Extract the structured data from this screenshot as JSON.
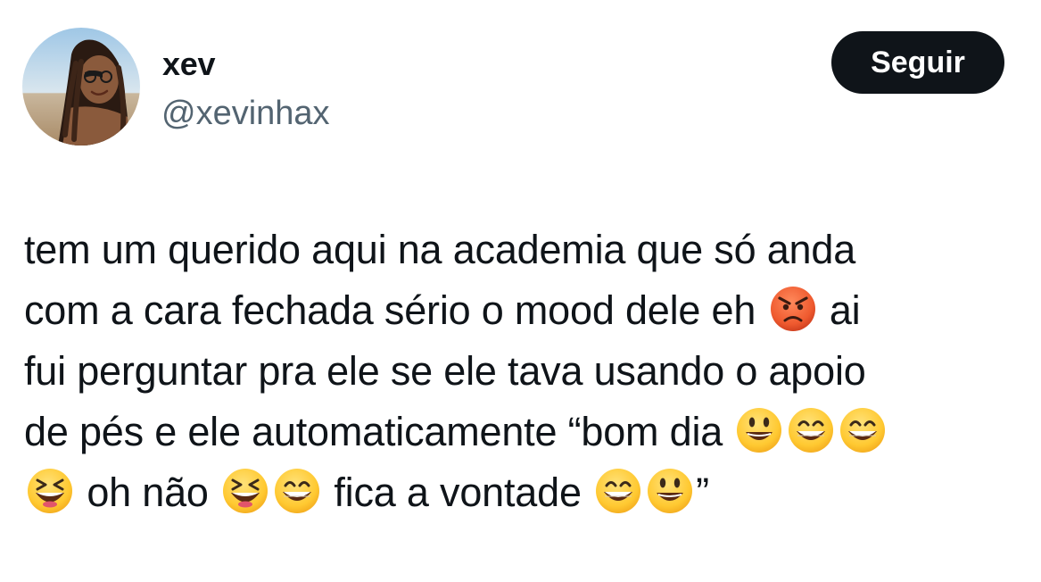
{
  "user": {
    "display_name": "xev",
    "handle": "@xevinhax",
    "avatar_icon": "profile-photo"
  },
  "actions": {
    "follow_label": "Seguir"
  },
  "tweet": {
    "line1": "tem um querido aqui na academia que só anda",
    "line2_a": "com a cara fechada sério o mood dele eh",
    "line2_b": "ai",
    "line3": "fui perguntar pra ele se ele tava usando o apoio",
    "line4_a": "de pés e ele automaticamente “bom dia",
    "line5_a": "oh não",
    "line5_b": "fica a vontade",
    "line5_c": "”"
  },
  "emojis": {
    "angry": "angry-face",
    "smiley": "grinning-face-big-eyes",
    "grin": "beaming-face-smiling-eyes",
    "laugh": "grinning-squinting-face"
  },
  "colors": {
    "text": "#0f1419",
    "secondary": "#536471",
    "button_bg": "#0f1419",
    "button_fg": "#ffffff",
    "emoji_yellow": "#ffcc33",
    "emoji_angry": "#e4572e"
  }
}
